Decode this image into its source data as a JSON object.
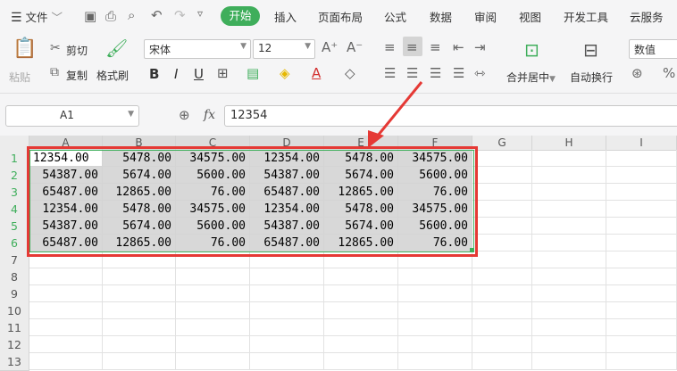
{
  "menu": {
    "file": "文件",
    "tabs": [
      "开始",
      "插入",
      "页面布局",
      "公式",
      "数据",
      "审阅",
      "视图",
      "开发工具",
      "云服务"
    ]
  },
  "ribbon": {
    "paste": "粘贴",
    "cut": "剪切",
    "copy": "复制",
    "format_painter": "格式刷",
    "font_name": "宋体",
    "font_size": "12",
    "merge_center": "合并居中",
    "wrap_text": "自动换行",
    "number_format": "数值"
  },
  "formula_bar": {
    "name_box": "A1",
    "fx": "fx",
    "value": "12354"
  },
  "sheet": {
    "columns": [
      "A",
      "B",
      "C",
      "D",
      "E",
      "F",
      "G",
      "H",
      "I"
    ],
    "rows": [
      "1",
      "2",
      "3",
      "4",
      "5",
      "6",
      "7",
      "8",
      "9",
      "10",
      "11",
      "12",
      "13"
    ],
    "data": [
      [
        "12354.00",
        "5478.00",
        "34575.00",
        "12354.00",
        "5478.00",
        "34575.00"
      ],
      [
        "54387.00",
        "5674.00",
        "5600.00",
        "54387.00",
        "5674.00",
        "5600.00"
      ],
      [
        "65487.00",
        "12865.00",
        "76.00",
        "65487.00",
        "12865.00",
        "76.00"
      ],
      [
        "12354.00",
        "5478.00",
        "34575.00",
        "12354.00",
        "5478.00",
        "34575.00"
      ],
      [
        "54387.00",
        "5674.00",
        "5600.00",
        "54387.00",
        "5674.00",
        "5600.00"
      ],
      [
        "65487.00",
        "12865.00",
        "76.00",
        "65487.00",
        "12865.00",
        "76.00"
      ]
    ]
  },
  "colors": {
    "accent": "#3fae5b",
    "highlight_border": "#e53935",
    "selection_fill": "#d8d8d8"
  }
}
